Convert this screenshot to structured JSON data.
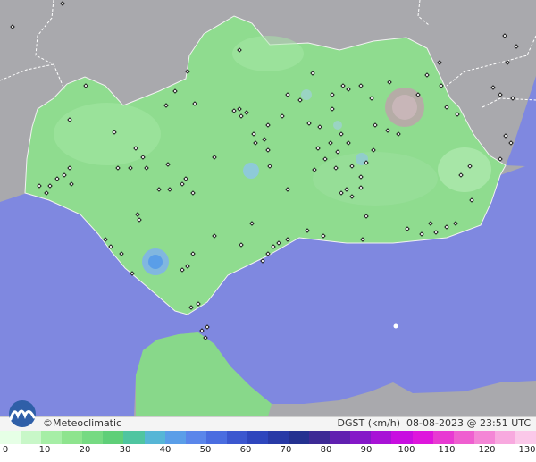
{
  "footer": {
    "brand_symbol": "©",
    "brand_name": "Meteoclimatic",
    "variable": "DGST",
    "unit": "(km/h)",
    "date": "08-08-2023",
    "at": "@",
    "time": "23:51",
    "timezone": "UTC"
  },
  "legend": {
    "ticks": [
      "0",
      "10",
      "20",
      "30",
      "40",
      "50",
      "60",
      "70",
      "80",
      "90",
      "100",
      "110",
      "120",
      "130"
    ],
    "colors": [
      "#e6ffe6",
      "#c8f7c8",
      "#a6eea6",
      "#8ee48e",
      "#76da82",
      "#5fcf78",
      "#4fc5a0",
      "#56b6d6",
      "#5a9ee8",
      "#5a86ea",
      "#4a6de0",
      "#3b57cf",
      "#2e46bd",
      "#283aa6",
      "#243190",
      "#3d2a95",
      "#6020b0",
      "#8518c8",
      "#a812d6",
      "#c80ee0",
      "#de16dc",
      "#e83ad2",
      "#ef5fd0",
      "#f486d6",
      "#f8a9df",
      "#fbc8e9"
    ]
  },
  "colors": {
    "sea": "#7f88e0",
    "land_outside": "#a9a9ad",
    "andalusia_land": "#8fdc8f",
    "morocco_land": "#88d88a"
  },
  "station_count_note": "stations shown as small diamond markers"
}
